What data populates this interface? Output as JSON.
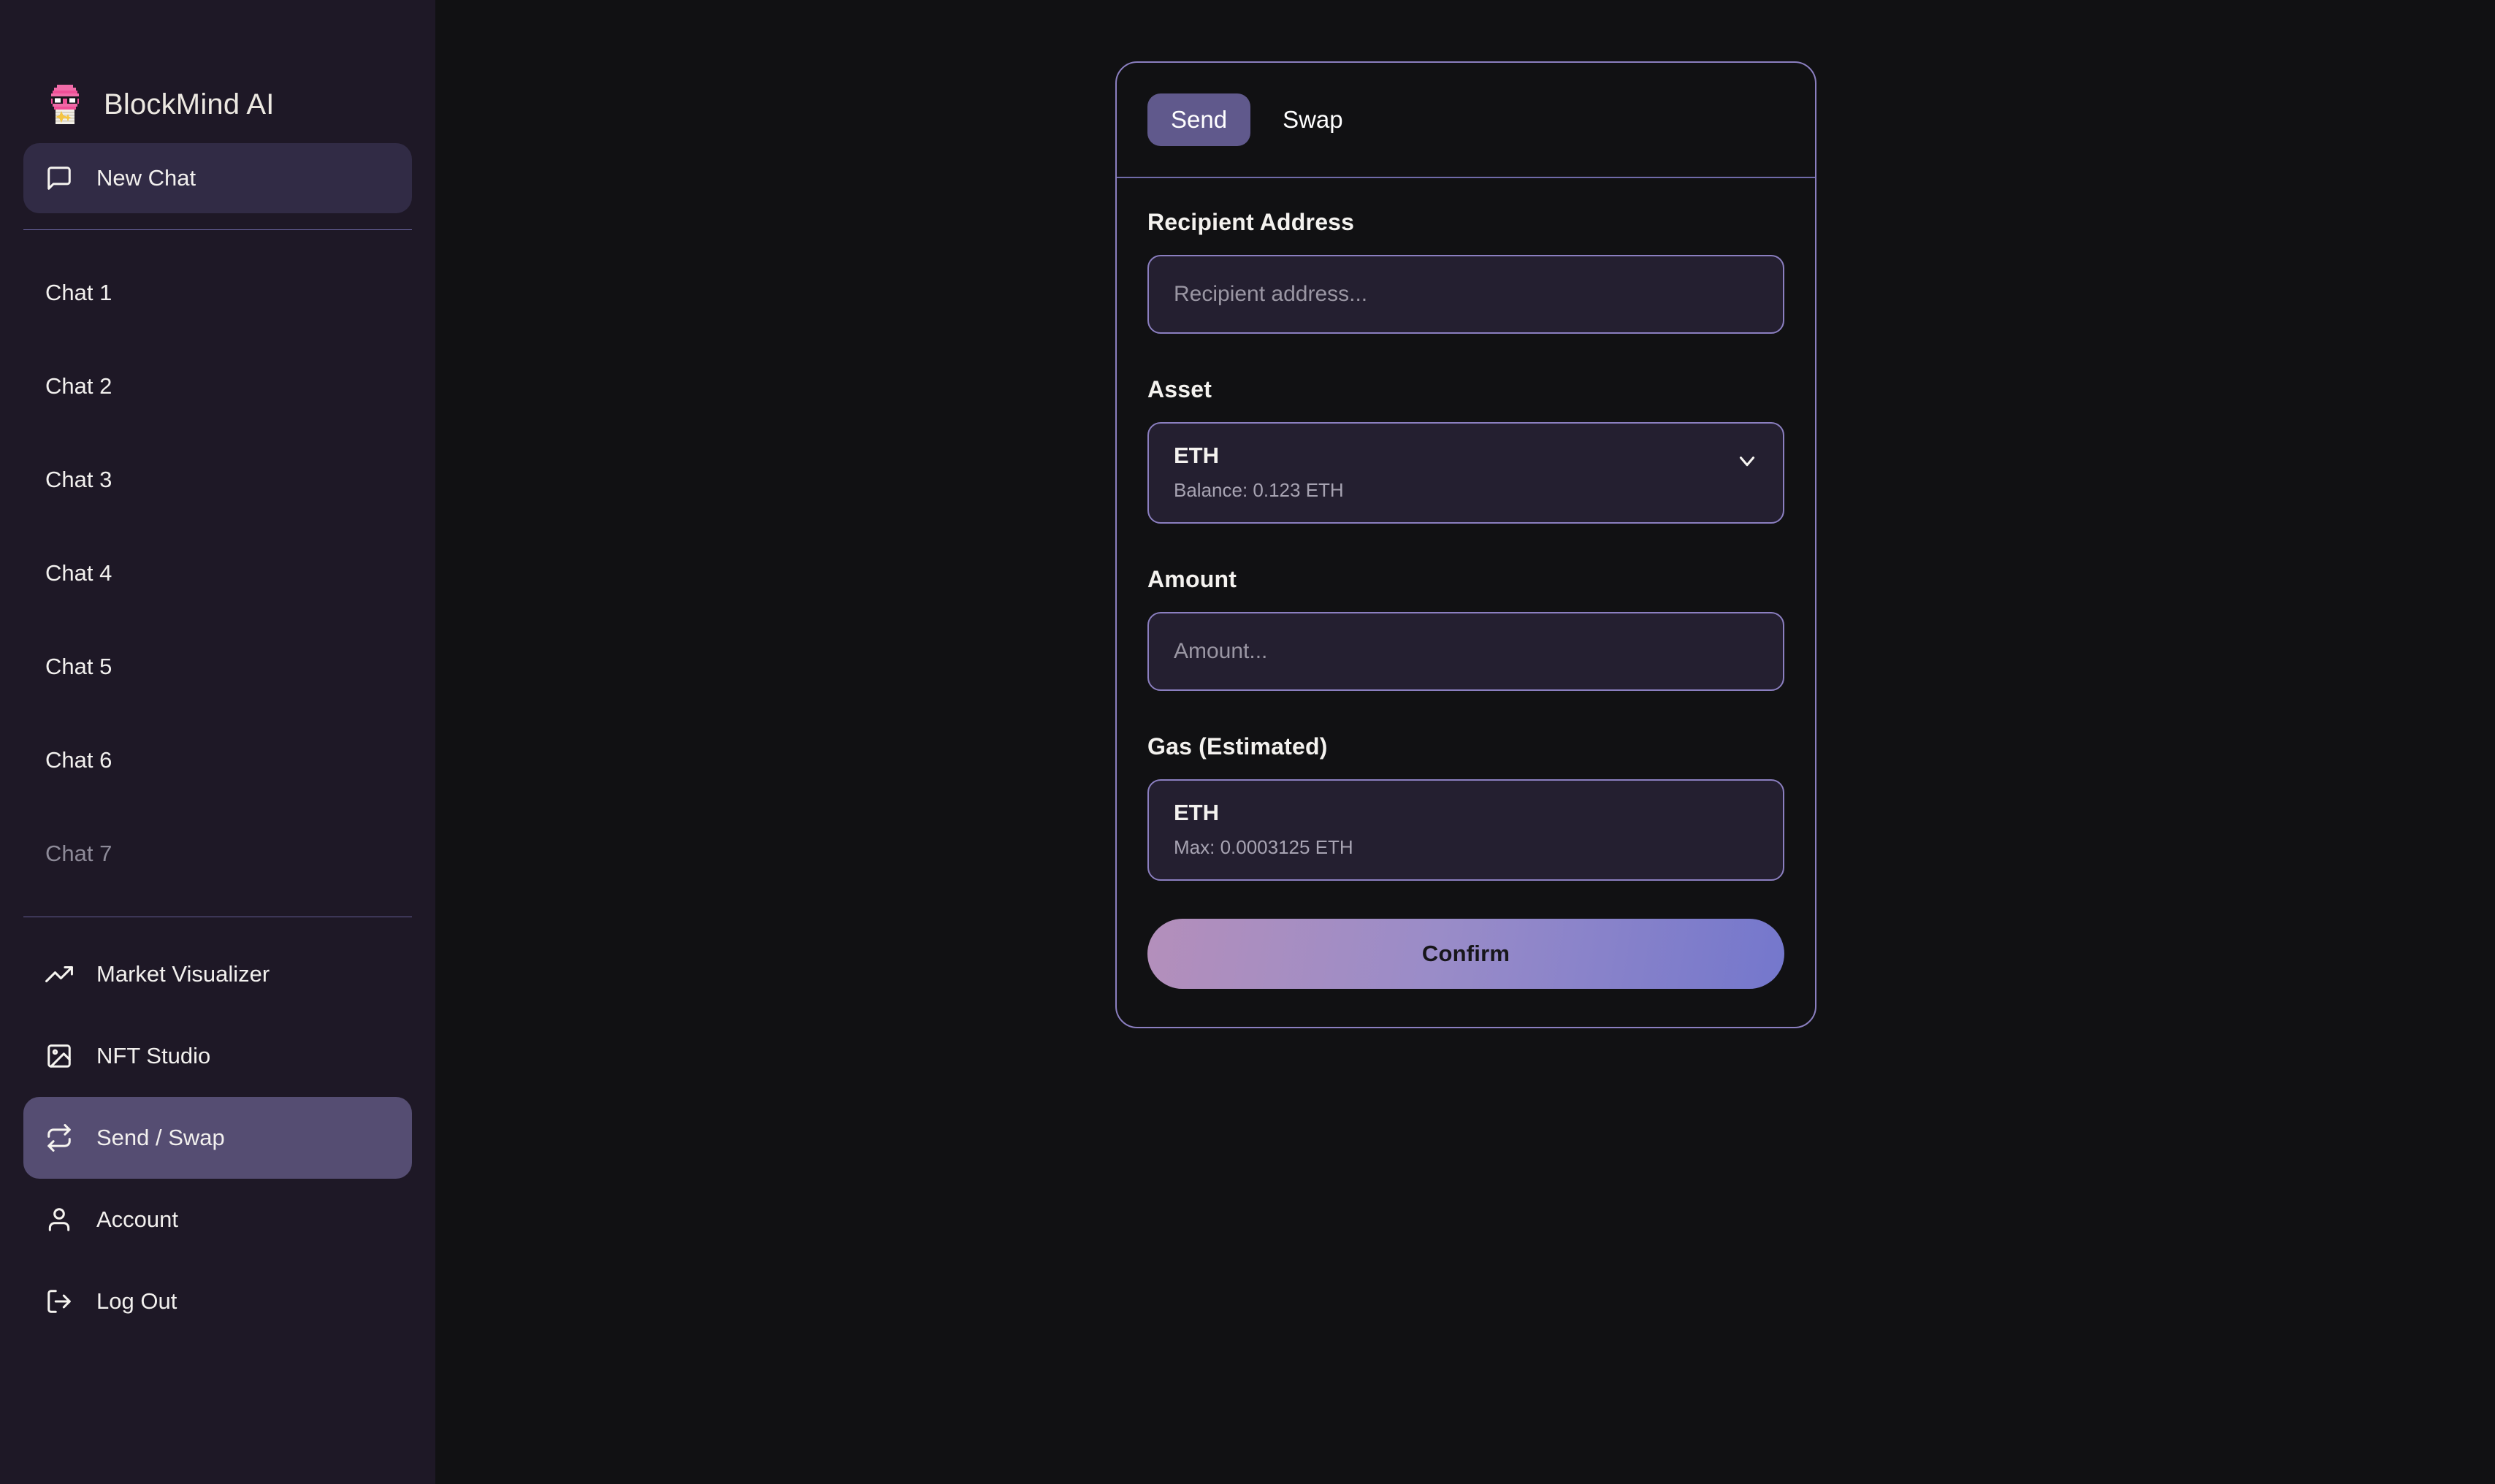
{
  "brand": {
    "title": "BlockMind AI",
    "logo_icon": "pixel-brain-sunglasses-icon"
  },
  "sidebar": {
    "new_chat": {
      "label": "New Chat",
      "icon": "message-square-icon"
    },
    "chats": [
      {
        "label": "Chat 1",
        "faded": false
      },
      {
        "label": "Chat 2",
        "faded": false
      },
      {
        "label": "Chat 3",
        "faded": false
      },
      {
        "label": "Chat 4",
        "faded": false
      },
      {
        "label": "Chat 5",
        "faded": false
      },
      {
        "label": "Chat 6",
        "faded": false
      },
      {
        "label": "Chat 7",
        "faded": true
      }
    ],
    "tools": [
      {
        "label": "Market Visualizer",
        "icon": "trending-up-icon",
        "active": false
      },
      {
        "label": "NFT Studio",
        "icon": "image-icon",
        "active": false
      },
      {
        "label": "Send / Swap",
        "icon": "repeat-swap-icon",
        "active": true
      },
      {
        "label": "Account",
        "icon": "user-icon",
        "active": false
      },
      {
        "label": "Log Out",
        "icon": "log-out-icon",
        "active": false
      }
    ]
  },
  "panel": {
    "tabs": [
      {
        "label": "Send",
        "selected": true
      },
      {
        "label": "Swap",
        "selected": false
      }
    ],
    "recipient": {
      "label": "Recipient Address",
      "placeholder": "Recipient address...",
      "value": ""
    },
    "asset": {
      "label": "Asset",
      "symbol": "ETH",
      "balance": "Balance: 0.123 ETH",
      "chevron_icon": "chevron-down-icon"
    },
    "amount": {
      "label": "Amount",
      "placeholder": "Amount...",
      "value": ""
    },
    "gas": {
      "label": "Gas (Estimated)",
      "symbol": "ETH",
      "max": "Max: 0.0003125 ETH"
    },
    "confirm": {
      "label": "Confirm"
    }
  },
  "colors": {
    "sidebar_bg": "#1e1826",
    "main_bg": "#111113",
    "accent_border": "#8b7fc0",
    "active_nav": "#554d72",
    "soft_nav": "#312b45",
    "tab_selected": "#60598c",
    "input_bg": "#241f30",
    "confirm_gradient_start": "#b48fbb",
    "confirm_gradient_end": "#7477cc"
  }
}
